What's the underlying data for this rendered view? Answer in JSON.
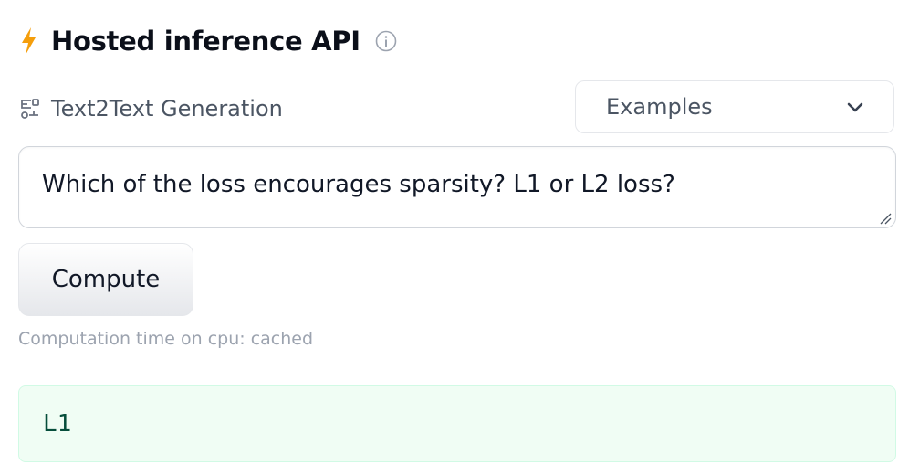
{
  "header": {
    "title": "Hosted inference API",
    "icons": {
      "bolt": "lightning-bolt-icon",
      "info": "info-icon"
    },
    "bolt_color": "#f59e0b"
  },
  "task": {
    "icon": "text-generation-icon",
    "label": "Text2Text Generation"
  },
  "examples_dropdown": {
    "label": "Examples",
    "icon": "chevron-down-icon"
  },
  "input": {
    "value": "Which of the loss encourages sparsity? L1 or L2 loss?"
  },
  "compute_button": {
    "label": "Compute"
  },
  "status": {
    "computation_time": "Computation time on cpu: cached"
  },
  "output": {
    "value": "L1",
    "background_color": "#f0fdf4"
  }
}
